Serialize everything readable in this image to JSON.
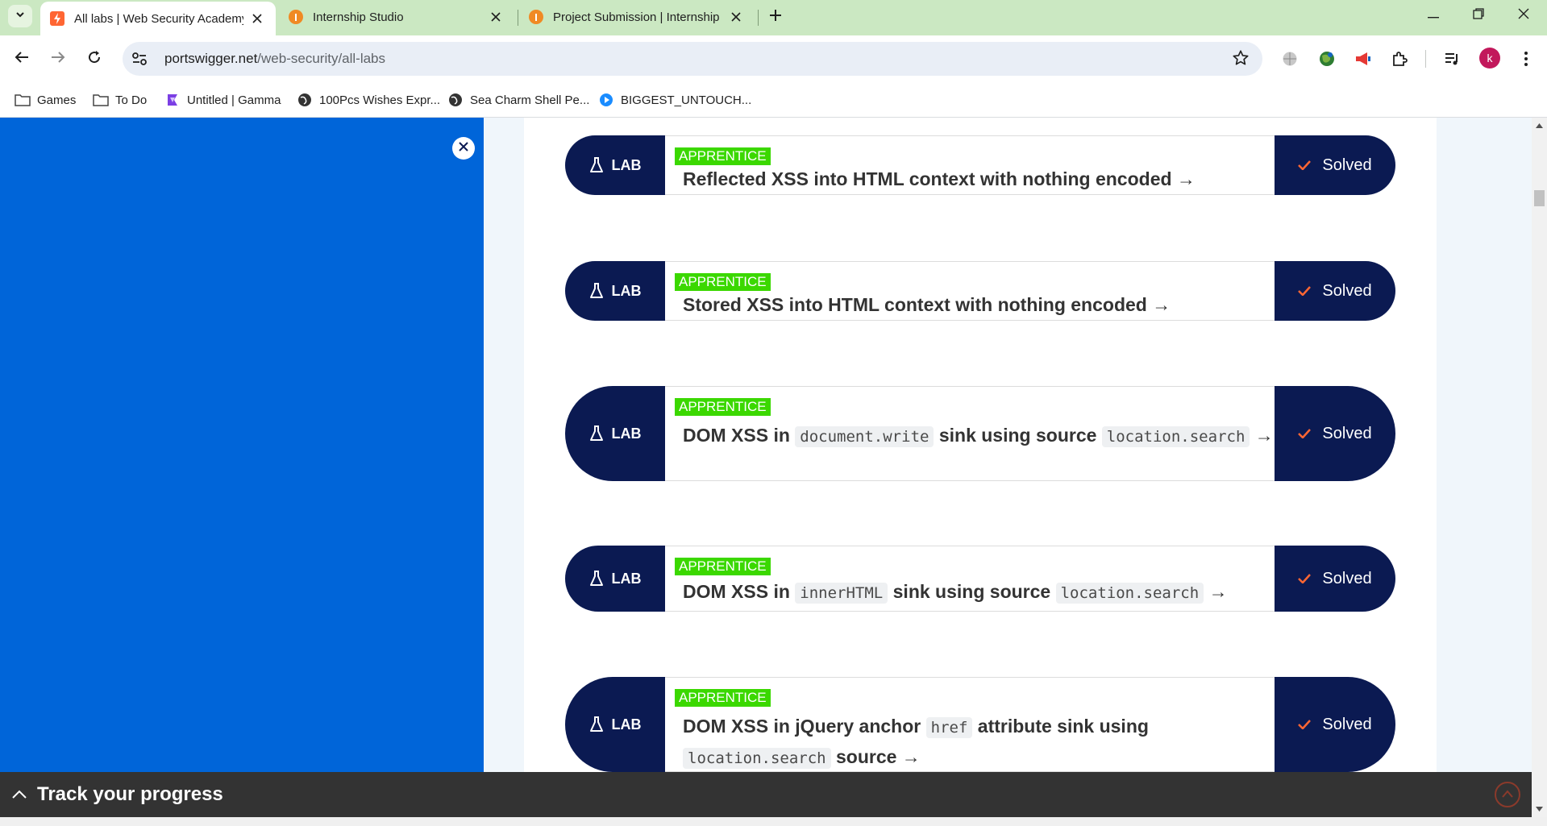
{
  "browser": {
    "tabs": [
      {
        "title": "All labs | Web Security Academy",
        "active": true
      },
      {
        "title": "Internship Studio",
        "active": false
      },
      {
        "title": "Project Submission | Internship",
        "active": false
      }
    ],
    "url_domain": "portswigger.net",
    "url_path": "/web-security/all-labs",
    "profile_initial": "k",
    "bookmarks": [
      {
        "label": "Games",
        "icon": "folder-icon"
      },
      {
        "label": "To Do",
        "icon": "folder-icon"
      },
      {
        "label": "Untitled | Gamma",
        "icon": "gamma-icon"
      },
      {
        "label": "100Pcs Wishes Expr...",
        "icon": "globe-icon"
      },
      {
        "label": "Sea Charm Shell Pe...",
        "icon": "globe-icon"
      },
      {
        "label": "BIGGEST_UNTOUCH...",
        "icon": "play-icon"
      }
    ]
  },
  "labs": [
    {
      "badge": "LAB",
      "level": "APPRENTICE",
      "title_parts": [
        "Reflected XSS into HTML context with nothing encoded →"
      ],
      "status": "Solved"
    },
    {
      "badge": "LAB",
      "level": "APPRENTICE",
      "title_parts": [
        "Stored XSS into HTML context with nothing encoded →"
      ],
      "status": "Solved"
    },
    {
      "badge": "LAB",
      "level": "APPRENTICE",
      "title_text_1": "DOM XSS in ",
      "title_code_1": "document.write",
      "title_text_2": " sink using source ",
      "title_code_2": "location.search",
      "title_text_3": " →",
      "status": "Solved"
    },
    {
      "badge": "LAB",
      "level": "APPRENTICE",
      "title_text_1": "DOM XSS in ",
      "title_code_1": "innerHTML",
      "title_text_2": " sink using source ",
      "title_code_2": "location.search",
      "title_text_3": " →",
      "status": "Solved"
    },
    {
      "badge": "LAB",
      "level": "APPRENTICE",
      "title_text_1": "DOM XSS in jQuery anchor ",
      "title_code_1": "href",
      "title_text_2": " attribute sink using ",
      "title_code_2": "location.search",
      "title_text_3": " source →",
      "status": "Solved"
    }
  ],
  "progress": {
    "label": "Track your progress"
  },
  "colors": {
    "tabstrip": "#cbe8c2",
    "side_panel": "#0065d9",
    "lab_navy": "#0b1a52",
    "apprentice_green": "#3bd800",
    "solved_check": "#ff6633"
  }
}
